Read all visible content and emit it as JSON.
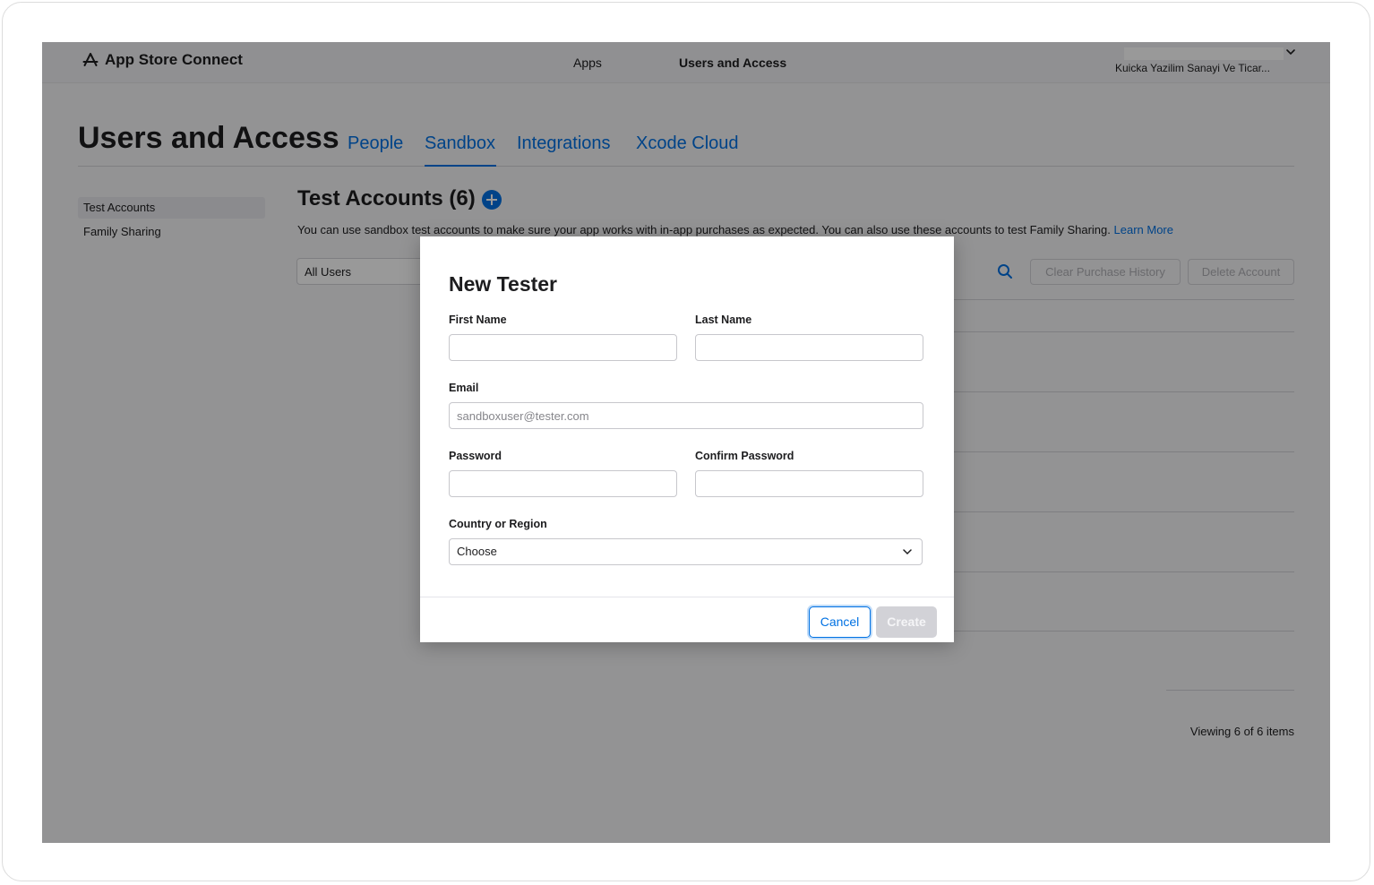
{
  "topbar": {
    "brand": "App Store Connect",
    "nav": [
      "Apps",
      "Users and Access"
    ],
    "account_name": "Kuicka Yazilim Sanayi Ve Ticar..."
  },
  "page": {
    "title": "Users and Access",
    "tabs": [
      "People",
      "Sandbox",
      "Integrations",
      "Xcode Cloud"
    ],
    "active_tab": "Sandbox"
  },
  "sidebar": {
    "items": [
      "Test Accounts",
      "Family Sharing"
    ],
    "selected": "Test Accounts"
  },
  "main": {
    "section_title": "Test Accounts (6)",
    "description": "You can use sandbox test accounts to make sure your app works with in-app purchases as expected. You can also use these accounts to test Family Sharing.",
    "learn_more": "Learn More",
    "filter_value": "All Users",
    "toolbar": {
      "clear_purchase_history": "Clear Purchase History",
      "delete_account": "Delete Account"
    },
    "viewing": "Viewing 6 of 6 items"
  },
  "modal": {
    "title": "New Tester",
    "first_name_label": "First Name",
    "last_name_label": "Last Name",
    "email_label": "Email",
    "email_placeholder": "sandboxuser@tester.com",
    "password_label": "Password",
    "confirm_password_label": "Confirm Password",
    "country_label": "Country or Region",
    "country_value": "Choose",
    "cancel": "Cancel",
    "create": "Create"
  },
  "colors": {
    "accent": "#0071e3",
    "overlay": "rgba(0,0,0,0.40)"
  },
  "icons": [
    "app-store-icon",
    "chevron-down-icon",
    "add-icon",
    "search-icon"
  ]
}
